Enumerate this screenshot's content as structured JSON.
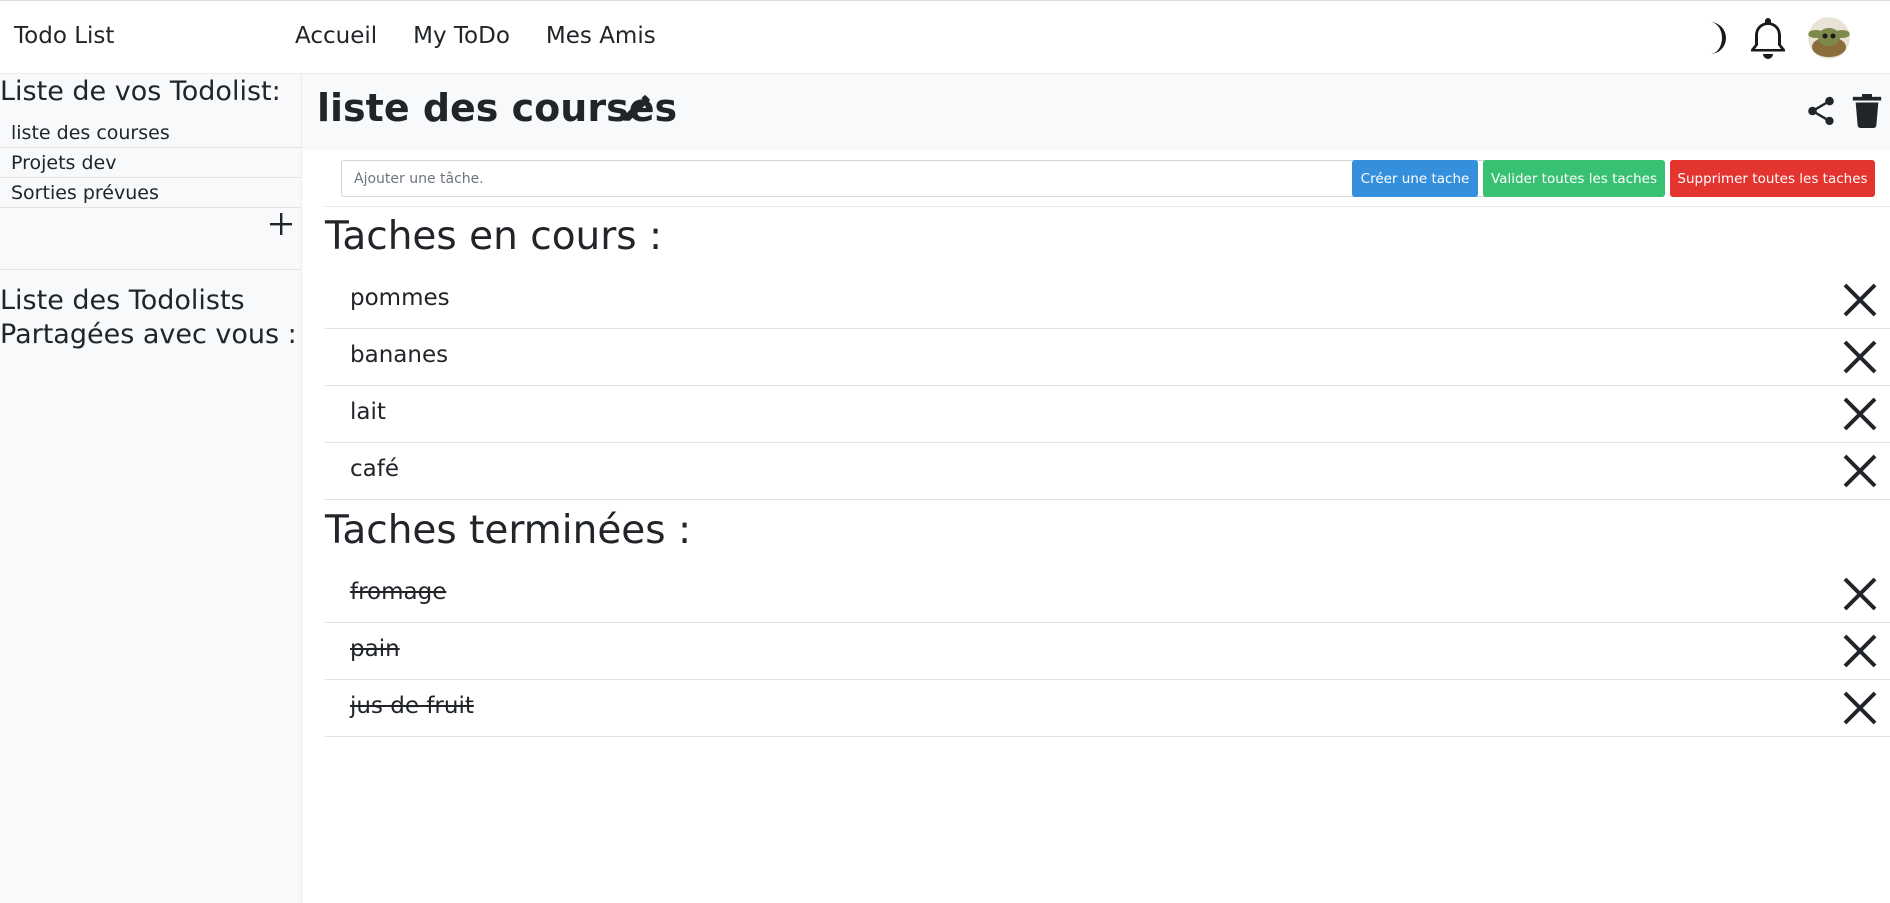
{
  "nav": {
    "brand": "Todo List",
    "links": [
      "Accueil",
      "My ToDo",
      "Mes Amis"
    ]
  },
  "sidebar": {
    "title": "Liste de vos Todolist:",
    "items": [
      "liste des courses",
      "Projets dev",
      "Sorties prévues"
    ],
    "shared_title_line1": "Liste des Todolists",
    "shared_title_line2": "Partagées avec vous :"
  },
  "main": {
    "title": "liste des courses",
    "input_placeholder": "Ajouter une tâche.",
    "buttons": {
      "create": "Créer une tache",
      "validate_all": "Valider toutes les taches",
      "delete_all": "Supprimer toutes les taches"
    },
    "in_progress_title": "Taches en cours :",
    "in_progress": [
      "pommes",
      "bananes",
      "lait",
      "café"
    ],
    "done_title": "Taches terminées :",
    "done": [
      "fromage",
      "pain",
      "jus de fruit"
    ]
  },
  "colors": {
    "primary": "#3490dc",
    "success": "#38c172",
    "danger": "#e3342f",
    "text": "#212529",
    "panel": "#f8f9fa"
  },
  "icons": [
    "moon-icon",
    "bell-icon",
    "avatar",
    "pencil-icon",
    "share-icon",
    "trash-icon",
    "plus-icon",
    "close-icon"
  ]
}
